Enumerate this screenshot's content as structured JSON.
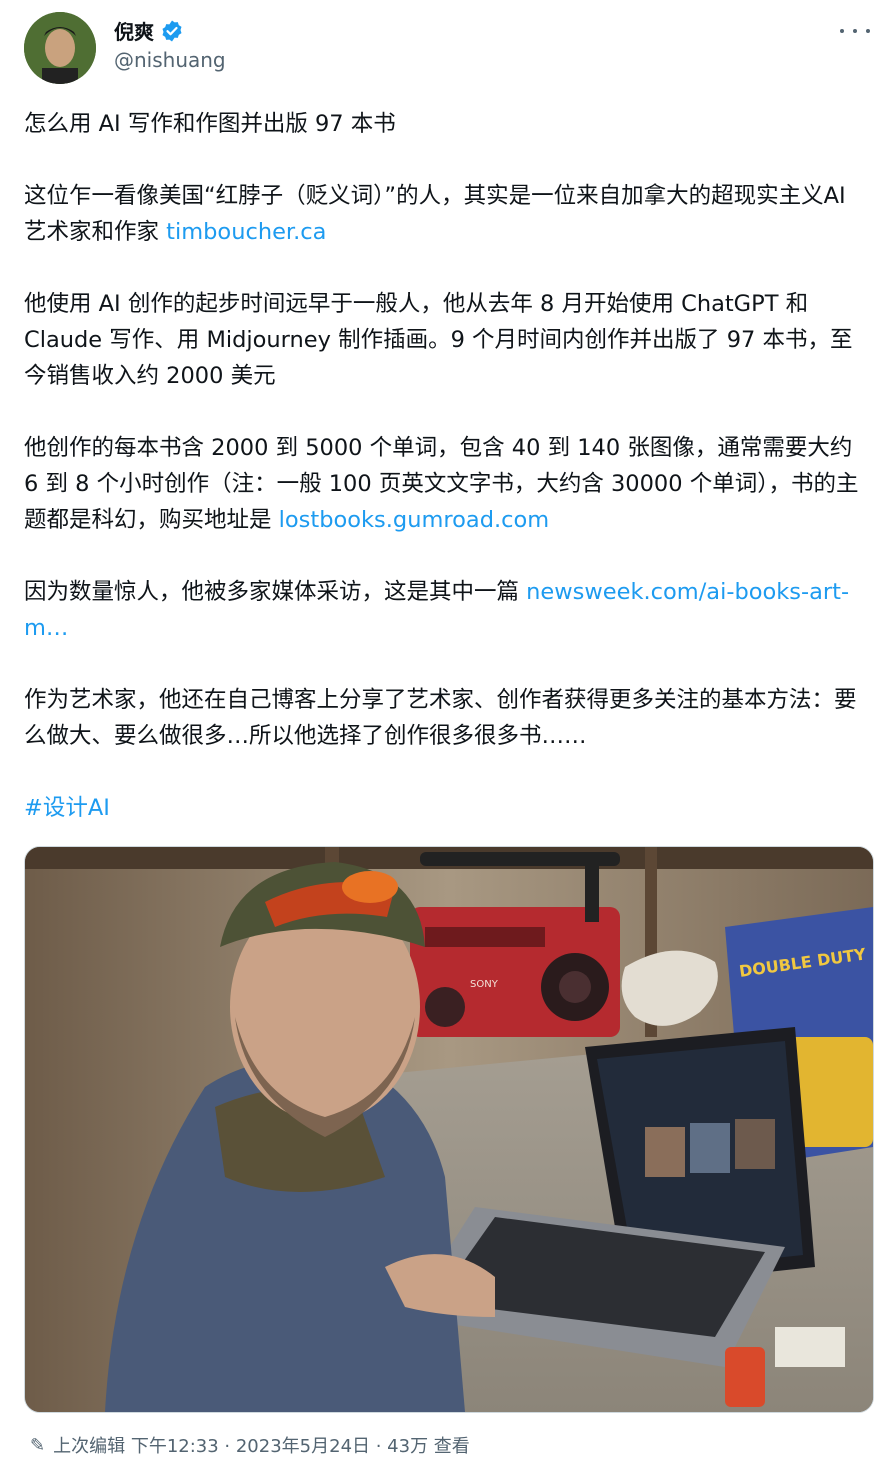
{
  "author": {
    "display_name": "倪爽",
    "handle": "@nishuang",
    "verified": true,
    "verified_color": "#1d9bf0"
  },
  "tweet": {
    "title": "怎么用 AI 写作和作图并出版 97 本书",
    "p1_text": "这位乍一看像美国“红脖子（贬义词）”的人，其实是一位来自加拿大的超现实主义AI 艺术家和作家 ",
    "p1_link": "timboucher.ca",
    "p2_text": "他使用 AI 创作的起步时间远早于一般人，他从去年 8 月开始使用 ChatGPT 和 Claude 写作、用 Midjourney 制作插画。9 个月时间内创作并出版了 97 本书，至今销售收入约 2000 美元",
    "p3_text": "他创作的每本书含 2000 到 5000 个单词，包含 40 到 140 张图像，通常需要大约 6 到 8 个小时创作（注：一般 100 页英文文字书，大约含 30000 个单词），书的主题都是科幻，购买地址是 ",
    "p3_link": "lostbooks.gumroad.com",
    "p4_text": "因为数量惊人，他被多家媒体采访，这是其中一篇 ",
    "p4_link": "newsweek.com/ai-books-art-m…",
    "p5_text": "作为艺术家，他还在自己博客上分享了艺术家、创作者获得更多关注的基本方法：要么做大、要么做很多…所以他选择了创作很多很多书……",
    "hashtag": "#设计AI",
    "link_color": "#1d9bf0"
  },
  "media": {
    "boombox_brand": "SONY",
    "box_text": "DOUBLE DUTY"
  },
  "footer": {
    "text": "上次编辑 下午12:33 · 2023年5月24日 · 43万 查看"
  }
}
